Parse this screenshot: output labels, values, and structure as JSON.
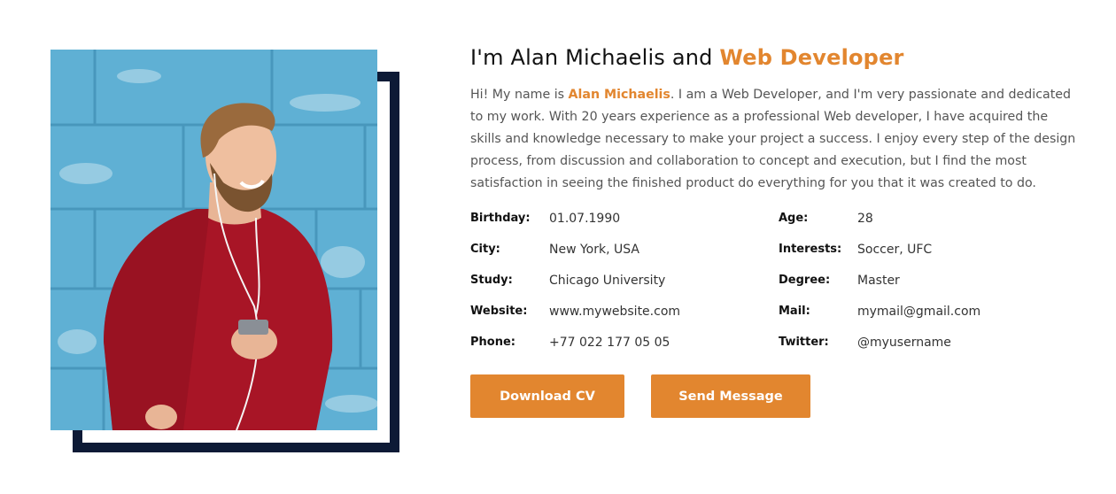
{
  "about": {
    "heading_prefix": "I'm Alan Michaelis and ",
    "heading_accent": "Web Developer",
    "bio_prefix": "Hi! My name is ",
    "bio_name": "Alan Michaelis",
    "bio_rest": ". I am a Web Developer, and I'm very passionate and dedicated to my work. With 20 years experience as a professional Web developer, I have acquired the skills and knowledge necessary to make your project a success. I enjoy every step of the design process, from discussion and collaboration to concept and execution, but I find the most satisfaction in seeing the finished product do everything for you that it was created to do.",
    "info": [
      {
        "left_label": "Birthday:",
        "left_value": "01.07.1990",
        "right_label": "Age:",
        "right_value": "28"
      },
      {
        "left_label": "City:",
        "left_value": "New York, USA",
        "right_label": "Interests:",
        "right_value": "Soccer, UFC"
      },
      {
        "left_label": "Study:",
        "left_value": "Chicago University",
        "right_label": "Degree:",
        "right_value": "Master"
      },
      {
        "left_label": "Website:",
        "left_value": "www.mywebsite.com",
        "right_label": "Mail:",
        "right_value": "mymail@gmail.com"
      },
      {
        "left_label": "Phone:",
        "left_value": "+77 022 177 05 05",
        "right_label": "Twitter:",
        "right_value": "@myusername"
      }
    ],
    "buttons": {
      "download_label": "Download CV",
      "message_label": "Send Message"
    }
  },
  "colors": {
    "accent": "#e2862f",
    "frame": "#0d1a36"
  }
}
